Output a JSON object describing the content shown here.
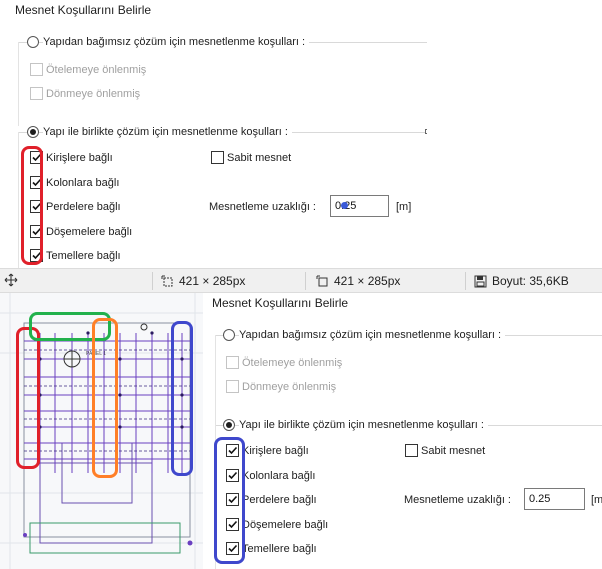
{
  "dialog": {
    "title": "Mesnet Koşullarını Belirle",
    "option_independent": {
      "label": "Yapıdan bağımsız çözüm için mesnetlenme koşulları  :",
      "selected": false,
      "checks": [
        {
          "label": "Ötelemeye önlenmiş",
          "checked": false
        },
        {
          "label": "Dönmeye önlenmiş",
          "checked": false
        }
      ]
    },
    "option_together": {
      "label": "Yapı ile birlikte çözüm için mesnetlenme koşulları  :",
      "selected": true,
      "checks": [
        {
          "label": "Kirişlere bağlı",
          "checked": true
        },
        {
          "label": "Kolonlara bağlı",
          "checked": true
        },
        {
          "label": "Perdelere bağlı",
          "checked": true
        },
        {
          "label": "Döşemelere bağlı",
          "checked": true
        },
        {
          "label": "Temellere bağlı",
          "checked": true
        }
      ]
    },
    "fixed_support": {
      "label": "Sabit mesnet",
      "checked": false
    },
    "support_distance": {
      "label": "Mesnetleme uzaklığı  :",
      "value_top": "0.25",
      "value_bottom": "0.25",
      "unit": "[m]",
      "unit_cut": "[m"
    }
  },
  "status_bar": {
    "selection_size": "421 × 285px",
    "canvas_size": "421 × 285px",
    "file_size": "Boyut: 35,6KB"
  },
  "drawing": {
    "note_text": "PANEL 1",
    "highlight_colors": {
      "red": "#e0202a",
      "green": "#22b14c",
      "orange": "#ff7f27",
      "blue": "#3f48cc"
    }
  }
}
